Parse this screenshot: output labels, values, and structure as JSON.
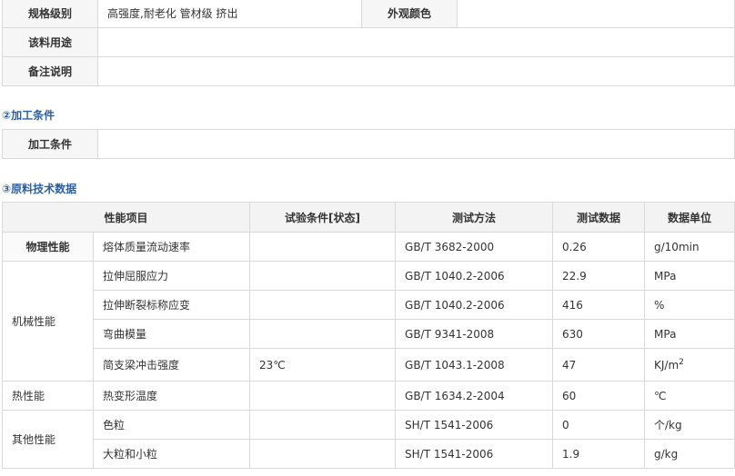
{
  "info": {
    "spec_label": "规格级别",
    "spec_value": "高强度,耐老化 管材级 挤出",
    "color_label": "外观颜色",
    "color_value": "",
    "usage_label": "该料用途",
    "usage_value": "",
    "note_label": "备注说明",
    "note_value": ""
  },
  "processing": {
    "section_title": "②加工条件",
    "label": "加工条件",
    "value": ""
  },
  "tech": {
    "section_title": "③原料技术数据",
    "headers": [
      "性能项目",
      "试验条件[状态]",
      "测试方法",
      "测试数据",
      "数据单位"
    ],
    "groups": [
      {
        "category": "物理性能",
        "rows": [
          {
            "item": "熔体质量流动速率",
            "condition": "",
            "method": "GB/T 3682-2000",
            "value": "0.26",
            "unit": "g/10min"
          }
        ]
      },
      {
        "category": "机械性能",
        "rows": [
          {
            "item": "拉伸屈服应力",
            "condition": "",
            "method": "GB/T 1040.2-2006",
            "value": "22.9",
            "unit": "MPa"
          },
          {
            "item": "拉伸断裂标称应变",
            "condition": "",
            "method": "GB/T 1040.2-2006",
            "value": "416",
            "unit": "%"
          },
          {
            "item": "弯曲模量",
            "condition": "",
            "method": "GB/T 9341-2008",
            "value": "630",
            "unit": "MPa"
          },
          {
            "item": "简支梁冲击强度",
            "condition": "23℃",
            "method": "GB/T 1043.1-2008",
            "value": "47",
            "unit": "KJ/m",
            "unit_sup": "2"
          }
        ]
      },
      {
        "category": "热性能",
        "rows": [
          {
            "item": "热变形温度",
            "condition": "",
            "method": "GB/T 1634.2-2004",
            "value": "60",
            "unit": "℃"
          }
        ]
      },
      {
        "category": "其他性能",
        "rows": [
          {
            "item": "色粒",
            "condition": "",
            "method": "SH/T 1541-2006",
            "value": "0",
            "unit": "个/kg"
          },
          {
            "item": "大粒和小粒",
            "condition": "",
            "method": "SH/T 1541-2006",
            "value": "1.9",
            "unit": "g/kg"
          }
        ]
      }
    ]
  }
}
